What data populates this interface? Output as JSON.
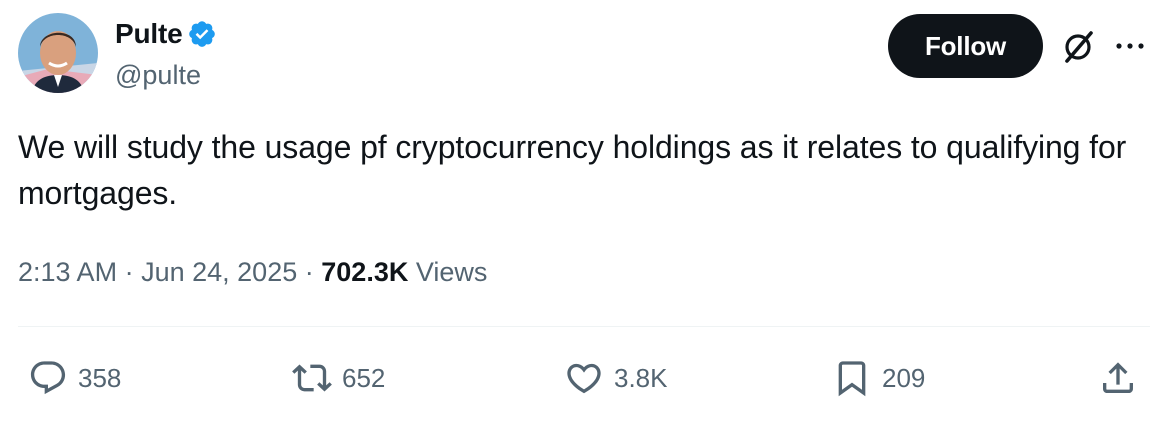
{
  "author": {
    "display_name": "Pulte",
    "handle": "@pulte",
    "verified": true,
    "verified_color": "#1d9bf0"
  },
  "header": {
    "follow_label": "Follow",
    "grok_icon": "grok-icon",
    "more_icon": "more-icon"
  },
  "tweet": {
    "text": "We will study the usage pf cryptocurrency holdings as it relates to qualifying for mortgages.",
    "time": "2:13 AM",
    "date": "Jun 24, 2025",
    "views_count": "702.3K",
    "views_label": "Views",
    "separator": "·"
  },
  "actions": {
    "replies": "358",
    "retweets": "652",
    "likes": "3.8K",
    "bookmarks": "209"
  },
  "colors": {
    "text": "#0f1419",
    "secondary": "#536471",
    "button_bg": "#0f1419",
    "divider": "#eff3f4"
  }
}
